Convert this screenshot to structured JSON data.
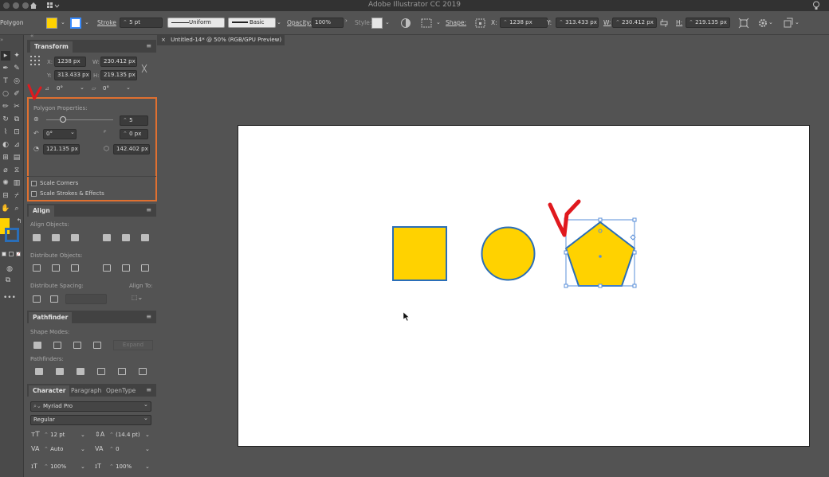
{
  "app": {
    "title": "Adobe Illustrator CC 2019"
  },
  "colors": {
    "fill": "#FFD200",
    "shape_stroke": "#2a6eb8",
    "highlight_box": "#e07030",
    "check_mark": "#e0191e",
    "artboard": "#ffffff",
    "canvas": "#535353"
  },
  "control_bar": {
    "tool_name": "Polygon",
    "stroke_label": "Stroke",
    "stroke_weight": "5 pt",
    "profile_label": "Uniform",
    "brush_label": "Basic",
    "opacity_label": "Opacity:",
    "opacity_value": "100%",
    "style_label": "Style:",
    "shape_label": "Shape:",
    "x_label": "X:",
    "x_value": "1238 px",
    "y_label": "Y:",
    "y_value": "313.433 px",
    "w_label": "W:",
    "w_value": "230.412 px",
    "h_label": "H:",
    "h_value": "219.135 px"
  },
  "document": {
    "tab_title": "Untitled-14* @ 50% (RGB/GPU Preview)",
    "close_glyph": "×"
  },
  "transform": {
    "title": "Transform",
    "x_label": "X:",
    "x": "1238 px",
    "w_label": "W:",
    "w": "230.412 px",
    "y_label": "Y:",
    "y": "313.433 px",
    "h_label": "H:",
    "h": "219.135 px",
    "angle": "0°",
    "shear": "0°"
  },
  "polygon_props": {
    "title": "Polygon Properties:",
    "sides": "5",
    "sides_fraction": 0.25,
    "rotation": "0°",
    "corner_radius": "0 px",
    "radius": "121.135 px",
    "side_length": "142.402 px",
    "scale_corners": "Scale Corners",
    "scale_strokes": "Scale Strokes & Effects"
  },
  "align": {
    "title": "Align",
    "align_objects": "Align Objects:",
    "distribute_objects": "Distribute Objects:",
    "distribute_spacing": "Distribute Spacing:",
    "align_to": "Align To:"
  },
  "pathfinder": {
    "title": "Pathfinder",
    "shape_modes": "Shape Modes:",
    "expand": "Expand",
    "pathfinders": "Pathfinders:"
  },
  "character": {
    "tabs": [
      "Character",
      "Paragraph",
      "OpenType"
    ],
    "font_family": "Myriad Pro",
    "font_style": "Regular",
    "font_size": "12 pt",
    "leading": "(14.4 pt)",
    "kerning": "Auto",
    "tracking": "0",
    "vscale": "100%",
    "hscale": "100%"
  },
  "icons": [
    "apple-logo-icon",
    "home-icon",
    "workspace-icon",
    "lightbulb-icon",
    "gear-icon",
    "checkmark-icon",
    "arrow-down-icon",
    "cursor-icon"
  ]
}
